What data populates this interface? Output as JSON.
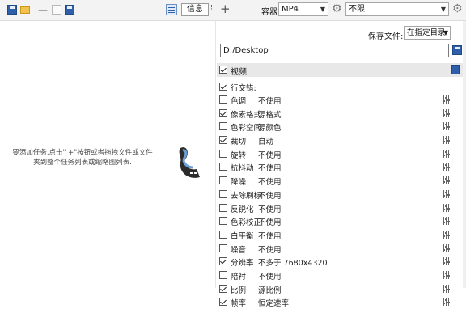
{
  "toolbar": {
    "minus_glyph": "—",
    "info_tab_label": "信息",
    "tab_more_glyph": "⁝",
    "add_tab_glyph": "+",
    "container_label": "容器:",
    "container_value": "MP4",
    "limit_value": "不限",
    "icons": [
      "save-icon",
      "open-folder-icon",
      "remove-icon",
      "file-icon",
      "save-as-icon",
      "list-view-icon",
      "gear-icon"
    ]
  },
  "left_panel": {
    "hint_line1": "要添加任务,点击\" +\"按钮或者拖拽文件或文件",
    "hint_line2": "夹到整个任务列表或缩略图列表."
  },
  "right_panel": {
    "save_to_label": "保存文件:",
    "save_to_value": "在指定目录",
    "path_value": "D:/Desktop",
    "video_section": {
      "label": "视频",
      "checked": true
    },
    "gop": {
      "label": "行交错:",
      "checked": true
    },
    "options": [
      {
        "name": "色调",
        "value": "不使用",
        "checked": false
      },
      {
        "name": "像素格式",
        "value": "源格式",
        "checked": true
      },
      {
        "name": "色彩空间",
        "value": "源颜色",
        "checked": false
      },
      {
        "name": "裁切",
        "value": "自动",
        "checked": true
      },
      {
        "name": "旋转",
        "value": "不使用",
        "checked": false
      },
      {
        "name": "抗抖动",
        "value": "不使用",
        "checked": false
      },
      {
        "name": "降噪",
        "value": "不使用",
        "checked": false
      },
      {
        "name": "去除刷标",
        "value": "不使用",
        "checked": false
      },
      {
        "name": "反锐化",
        "value": "不使用",
        "checked": false
      },
      {
        "name": "色彩校正",
        "value": "不使用",
        "checked": false
      },
      {
        "name": "白平衡",
        "value": "不使用",
        "checked": false
      },
      {
        "name": "噪音",
        "value": "不使用",
        "checked": false
      },
      {
        "name": "分辨率",
        "value": "不多于 7680x4320",
        "checked": true
      },
      {
        "name": "陪衬",
        "value": "不使用",
        "checked": false
      },
      {
        "name": "比例",
        "value": "源比例",
        "checked": true
      },
      {
        "name": "帧率",
        "value": "恒定速率",
        "checked": true
      }
    ]
  },
  "colors": {
    "accent_blue": "#2f5fa8",
    "folder_yellow": "#f2c14e",
    "header_gray": "#e8e8e8"
  }
}
